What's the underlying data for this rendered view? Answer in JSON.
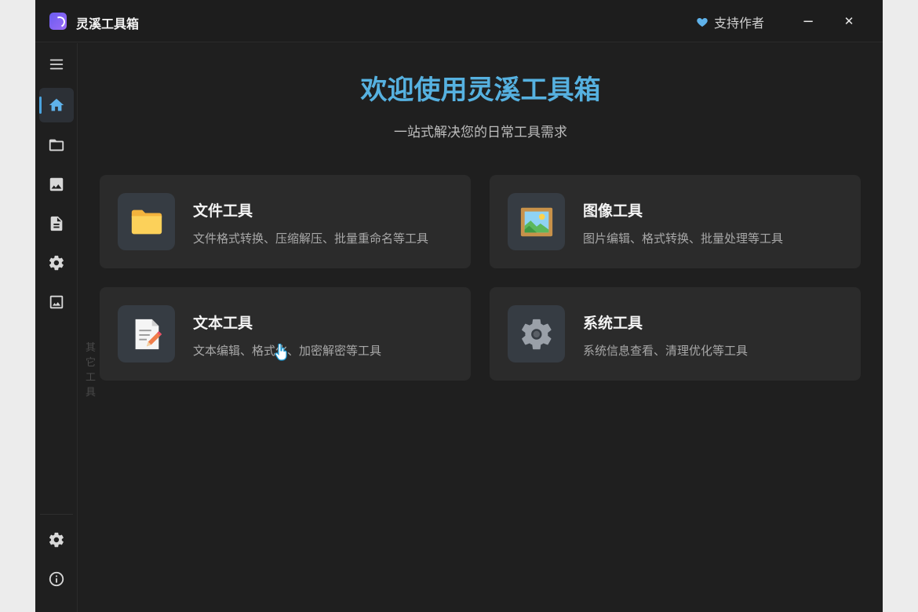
{
  "app": {
    "title": "灵溪工具箱",
    "support_label": "支持作者",
    "minimize_glyph": "−",
    "close_glyph": "✕"
  },
  "colors": {
    "accent": "#56b1e0",
    "background": "#1f1f1f",
    "card": "#2b2b2b",
    "heart": "#5fb2ea"
  },
  "sidebar": {
    "items": [
      {
        "icon": "menu-icon"
      },
      {
        "icon": "home-icon",
        "active": true
      },
      {
        "icon": "folder-icon"
      },
      {
        "icon": "image-icon"
      },
      {
        "icon": "document-icon"
      },
      {
        "icon": "gear-icon"
      },
      {
        "icon": "picture-icon",
        "tooltip": "其它工具"
      }
    ],
    "bottom_items": [
      {
        "icon": "settings-icon"
      },
      {
        "icon": "info-icon"
      }
    ]
  },
  "main": {
    "title": "欢迎使用灵溪工具箱",
    "subtitle": "一站式解决您的日常工具需求",
    "cards": [
      {
        "icon": "folder-icon",
        "title": "文件工具",
        "desc": "文件格式转换、压缩解压、批量重命名等工具"
      },
      {
        "icon": "framed-picture-icon",
        "title": "图像工具",
        "desc": "图片编辑、格式转换、批量处理等工具"
      },
      {
        "icon": "memo-icon",
        "title": "文本工具",
        "desc": "文本编辑、格式化、加密解密等工具"
      },
      {
        "icon": "gear-icon",
        "title": "系统工具",
        "desc": "系统信息查看、清理优化等工具"
      }
    ]
  }
}
